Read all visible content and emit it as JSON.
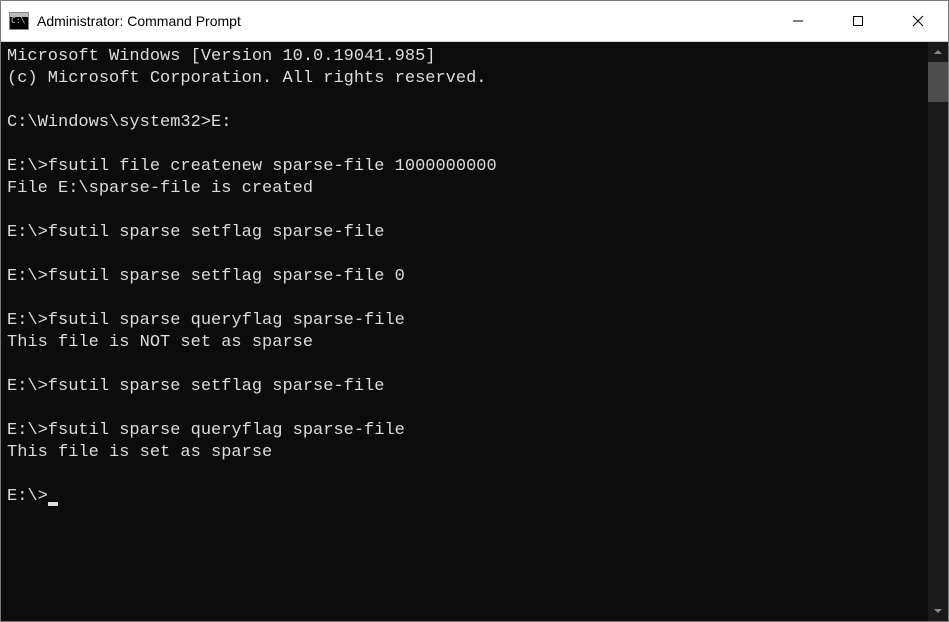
{
  "window": {
    "title": "Administrator: Command Prompt"
  },
  "terminal": {
    "lines": [
      "Microsoft Windows [Version 10.0.19041.985]",
      "(c) Microsoft Corporation. All rights reserved.",
      "",
      "C:\\Windows\\system32>E:",
      "",
      "E:\\>fsutil file createnew sparse-file 1000000000",
      "File E:\\sparse-file is created",
      "",
      "E:\\>fsutil sparse setflag sparse-file",
      "",
      "E:\\>fsutil sparse setflag sparse-file 0",
      "",
      "E:\\>fsutil sparse queryflag sparse-file",
      "This file is NOT set as sparse",
      "",
      "E:\\>fsutil sparse setflag sparse-file",
      "",
      "E:\\>fsutil sparse queryflag sparse-file",
      "This file is set as sparse",
      ""
    ],
    "current_prompt": "E:\\>"
  }
}
